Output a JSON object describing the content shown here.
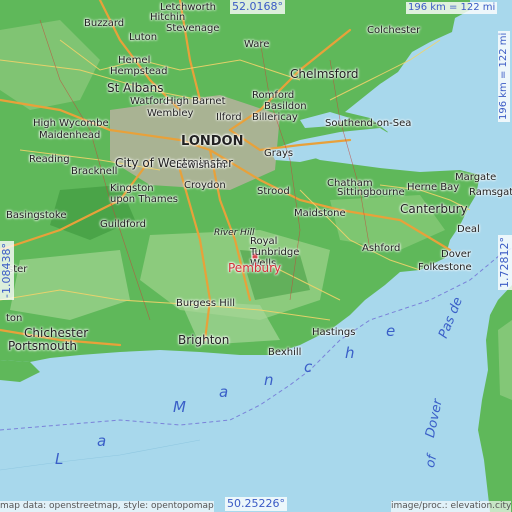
{
  "map": {
    "target_place": "Pembury",
    "colors": {
      "sea": "#a8d8ec",
      "land": "#5fb85a",
      "highland": "#9bd18a",
      "motorway": "#e8a13a",
      "urban": "#b6b29e",
      "water_label": "#3a5fc8",
      "target": "#d4303a"
    }
  },
  "coords": {
    "lat_top": "52.0168°",
    "lat_bottom": "50.25226°",
    "lon_left": "-1.08438°",
    "lon_right": "1.72812°"
  },
  "scale": {
    "horizontal": "196 km = 122 mi",
    "vertical": "196 km = 122 mi"
  },
  "footer": {
    "left": "map data: openstreetmap, style: opentopomap",
    "right": "image/proc.: elevation.city"
  },
  "water_labels": [
    "L",
    "a",
    "M",
    "a",
    "n",
    "c",
    "h",
    "e",
    "Pas de",
    "Dover",
    "of"
  ],
  "river_label": "River Hill",
  "places": [
    "Letchworth",
    "Luton",
    "Buzzard",
    "Hitchin",
    "Stevenage",
    "Ware",
    "Colchester",
    "Hemel",
    "Hempstead",
    "St Albans",
    "Chelmsford",
    "Watford",
    "High Barnet",
    "Romford",
    "Basildon",
    "Southend-on-Sea",
    "High Wycombe",
    "Wembley",
    "Ilford",
    "Billericay",
    "Maidenhead",
    "LONDON",
    "Reading",
    "City of Westminster",
    "Grays",
    "Bracknell",
    "Lewisham",
    "Chatham",
    "Kingston upon Thames",
    "Croydon",
    "Strood",
    "Margate",
    "Herne Bay",
    "Ramsgate",
    "Sittingbourne",
    "Canterbury",
    "Basingstoke",
    "Guildford",
    "Maidstone",
    "Deal",
    "Royal Tunbridge Wells",
    "Ashford",
    "Dover",
    "Folkestone",
    "ster",
    "Burgess Hill",
    "Hastings",
    "Bexhill",
    "Chichester",
    "Portsmouth",
    "Brighton",
    "ton"
  ]
}
